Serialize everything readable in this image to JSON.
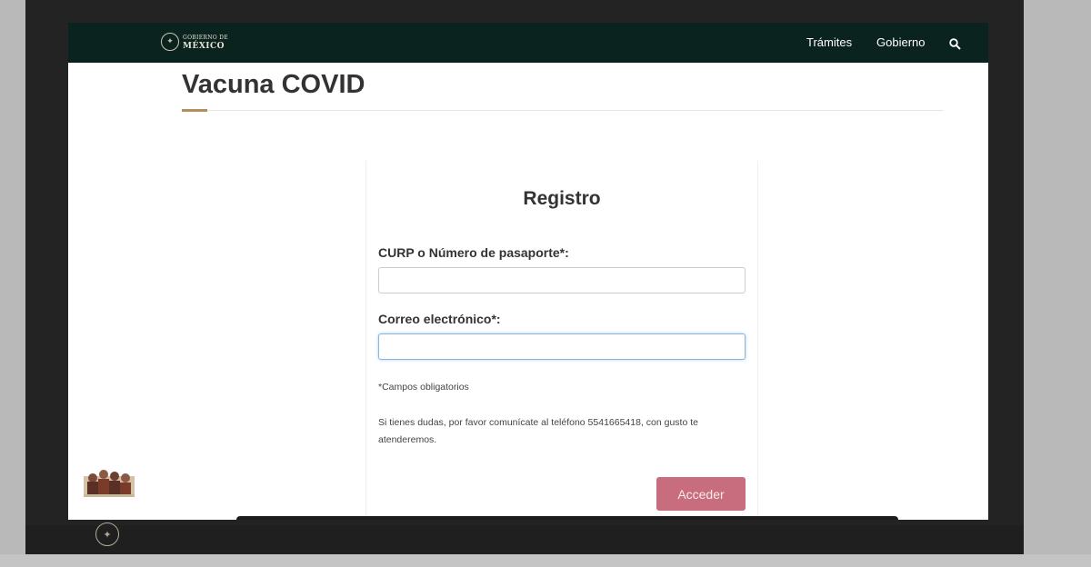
{
  "header": {
    "logo_line1": "GOBIERNO DE",
    "logo_line2": "MÉXICO",
    "nav": [
      {
        "label": "Trámites"
      },
      {
        "label": "Gobierno"
      }
    ],
    "search_icon": "search-icon"
  },
  "page": {
    "title": "Vacuna COVID"
  },
  "form": {
    "title": "Registro",
    "curp_label": "CURP o Número de pasaporte*:",
    "curp_value": "",
    "email_label": "Correo electrónico*:",
    "email_value": "",
    "required_note": "*Campos obligatorios",
    "help_text": "Si tienes dudas, por favor comunícate al teléfono 5541665418, con gusto te atenderemos.",
    "submit_label": "Acceder"
  },
  "colors": {
    "navbar": "#0b231e",
    "accent": "#b38e5d",
    "button": "#c86d7d"
  }
}
